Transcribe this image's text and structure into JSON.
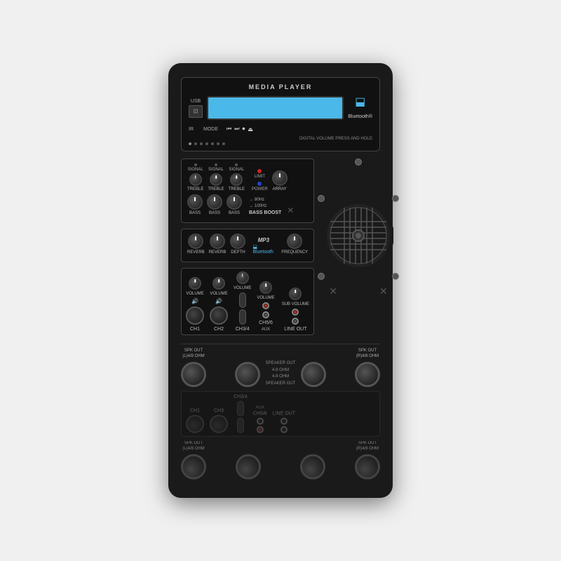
{
  "device": {
    "title": "MEDIA PLAYER",
    "bluetooth_symbol": "ℬ",
    "bluetooth_text": "Bluetooth®",
    "usb_label": "USB",
    "ir_label": "IR",
    "mode_label": "MODE",
    "digital_volume_label": "DIGITAL VOLUME PRESS AND HOLD",
    "controls": [
      "⏮",
      "⏭",
      "⏺",
      "⏏"
    ],
    "channels": {
      "ch1_label": "CH1",
      "ch2_label": "CH2",
      "ch34_label": "CH3/4",
      "ch56_label": "CH5/6",
      "line_out_label": "LINE OUT"
    },
    "knobs": {
      "signal_label": "SIGNAL",
      "treble_label": "TREBLE",
      "bass_label": "BASS",
      "reverb_label": "REVERB",
      "depth_label": "DEPTH",
      "volume_label": "VOLUME",
      "array_label": "ARRAY"
    },
    "eq": {
      "limit_label": "LIMIT",
      "power_label": "POWER",
      "freq_80hz": "80Hz",
      "freq_100hz": "100Hz",
      "bass_boost_label": "BASS BOOST",
      "frequency_label": "FREQUENCY",
      "sub_volume_label": "SUB VOLUME"
    },
    "spk_out": {
      "left_label": "SPK OUT\n(L)4/8 OHM",
      "right_label": "SPK OUT\n(R)4/8 OHM",
      "center_line1": "SPEAKER OUT",
      "center_line2": "4-8 OHM",
      "center_line3": "4-8 OHM",
      "center_line4": "SPEAKER OUT"
    },
    "aux_label": "AUX",
    "mp3_label": "MP3",
    "colors": {
      "background": "#1a1a1a",
      "panel": "#111",
      "lcd": "#4ab8e8",
      "led_green": "#22cc44",
      "led_red": "#cc2222",
      "led_blue": "#2244cc"
    }
  }
}
